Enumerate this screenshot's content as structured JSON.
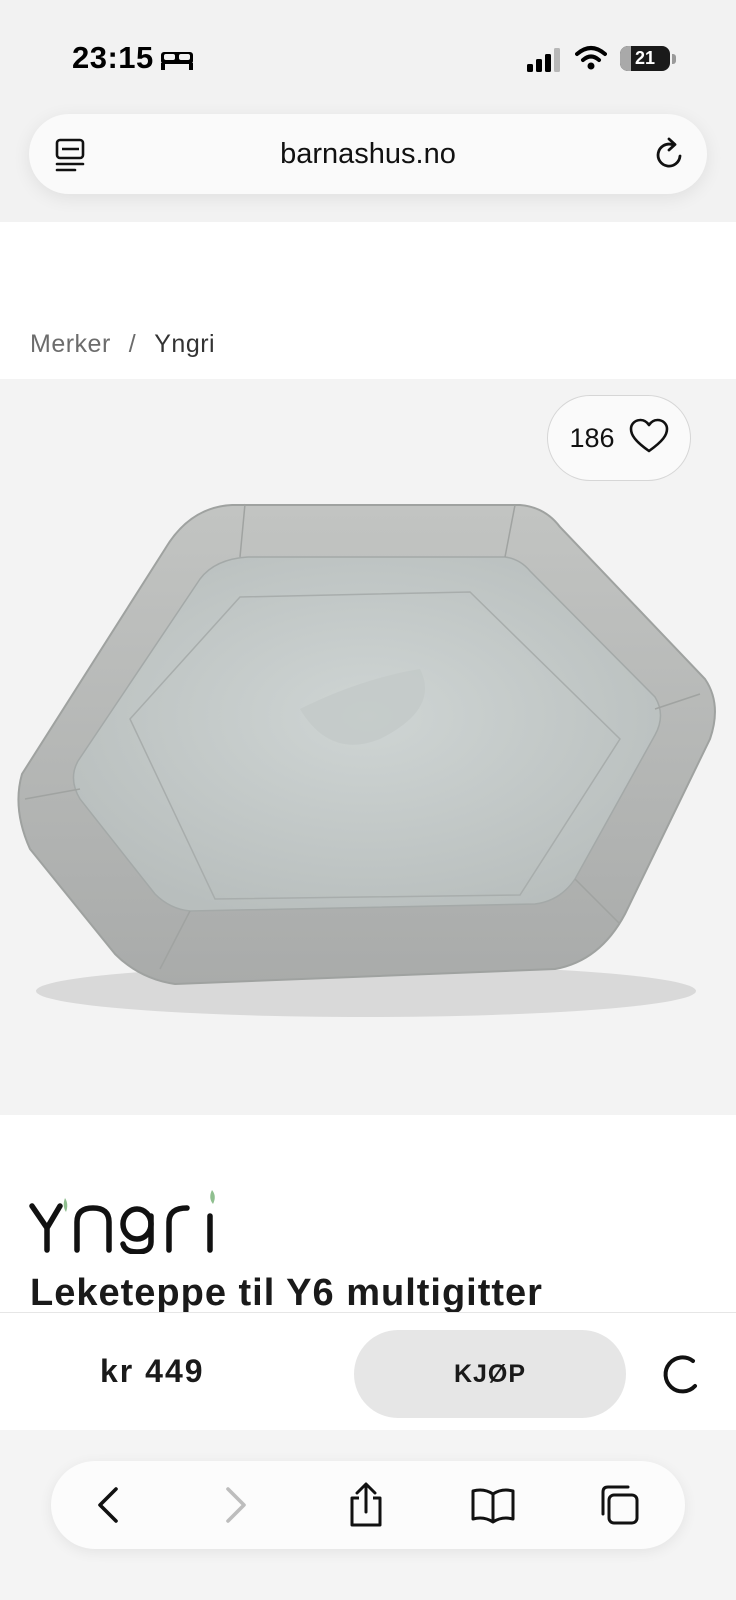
{
  "status_bar": {
    "time": "23:15",
    "battery_level": "21",
    "battery_fraction": 0.21
  },
  "browser": {
    "url": "barnashus.no"
  },
  "breadcrumb": {
    "items": [
      "Merker",
      "Yngri"
    ],
    "separator": "/"
  },
  "product": {
    "favorite_count": "186",
    "brand": "Yngri",
    "title": "Leketeppe til Y6 multigitter",
    "price": "kr 449",
    "buy_label": "KJØP"
  },
  "icons": {
    "sleep": "bed-icon",
    "reader": "reader-mode-icon",
    "reload": "reload-icon",
    "favorite": "heart-icon",
    "spinner": "loading-spinner-icon",
    "back": "chevron-left-icon",
    "forward": "chevron-right-icon",
    "share": "share-icon",
    "bookmarks": "book-icon",
    "tabs": "tabs-icon"
  },
  "colors": {
    "buy_button_bg": "#e6e6e6",
    "image_bg": "#f3f3f3",
    "logo_leaf_accent": "#8fbf8f"
  }
}
